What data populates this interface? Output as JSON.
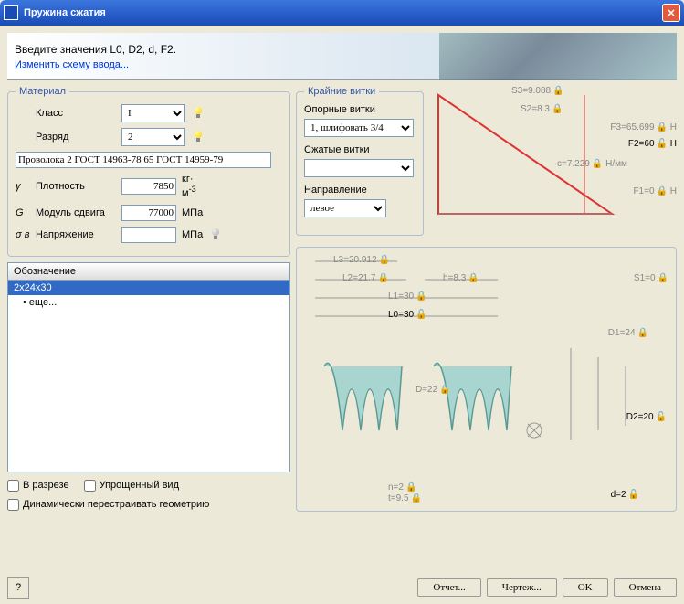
{
  "window": {
    "title": "Пружина сжатия"
  },
  "banner": {
    "prompt": "Введите значения L0, D2, d, F2.",
    "link": "Изменить схему ввода..."
  },
  "material": {
    "legend": "Материал",
    "class_label": "Класс",
    "class_value": "I",
    "grade_label": "Разряд",
    "grade_value": "2",
    "wire": "Проволока 2 ГОСТ 14963-78 65 ГОСТ 14959-79",
    "density_sym": "γ",
    "density_label": "Плотность",
    "density_value": "7850",
    "density_unit": "кг/м³",
    "shear_sym": "G",
    "shear_label": "Модуль сдвига",
    "shear_value": "77000",
    "shear_unit": "МПа",
    "stress_sym": "σ в",
    "stress_label": "Напряжение",
    "stress_value": "",
    "stress_unit": "МПа"
  },
  "end_coils": {
    "legend": "Крайние витки",
    "support_label": "Опорные витки",
    "support_value": "1, шлифовать 3/4",
    "closed_label": "Сжатые витки",
    "closed_value": "",
    "direction_label": "Направление",
    "direction_value": "левое"
  },
  "list": {
    "header": "Обозначение",
    "items": [
      {
        "text": "2x24x30",
        "selected": true
      },
      {
        "text": "еще...",
        "selected": false
      }
    ]
  },
  "checks": {
    "section": "В разрезе",
    "simple": "Упрощенный вид",
    "dynamic": "Динамически перестраивать геометрию"
  },
  "diagram": {
    "S3": "S3=9.088",
    "S2": "S2=8.3",
    "F3": "F3=65.699",
    "F2": "F2=60",
    "c": "c=7.229",
    "c_unit": "Н/мм",
    "F1": "F1=0",
    "L3": "L3=20.912",
    "L2": "L2=21.7",
    "h": "h=8.3",
    "S1": "S1=0",
    "L1": "L1=30",
    "L0": "L0=30",
    "D1": "D1=24",
    "D": "D=22",
    "D2": "D2=20",
    "n": "n=2",
    "t": "t=9.5",
    "d": "d=2",
    "H": "Н"
  },
  "buttons": {
    "report": "Отчет...",
    "drawing": "Чертеж...",
    "ok": "OK",
    "cancel": "Отмена"
  }
}
